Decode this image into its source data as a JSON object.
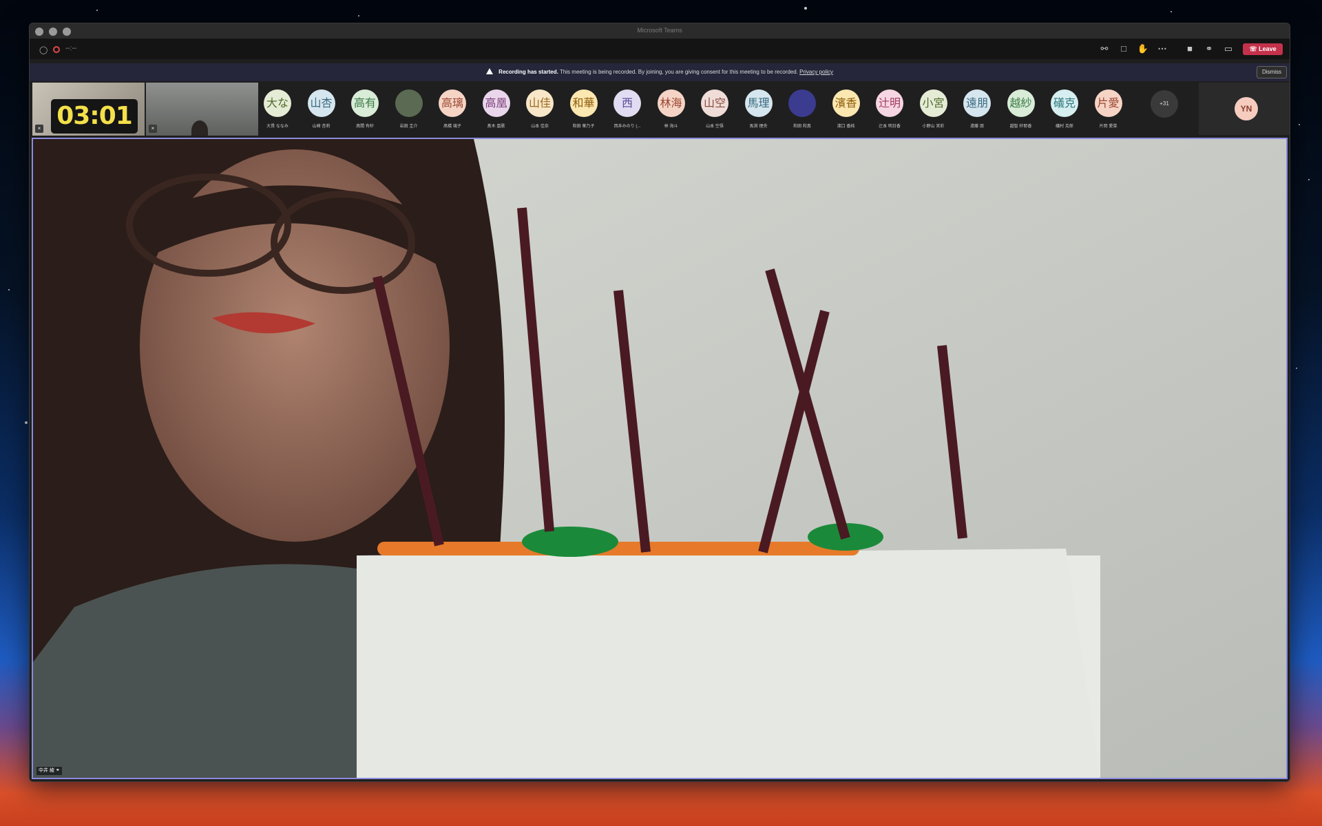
{
  "window": {
    "title": "Microsoft Teams"
  },
  "toolbar": {
    "call_timer": "--:--",
    "leave_label": "Leave"
  },
  "banner": {
    "title": "Recording has started.",
    "message": "This meeting is being recorded. By joining, you are giving consent for this meeting to be recorded.",
    "link": "Privacy policy",
    "dismiss_label": "Dismiss"
  },
  "video_tiles": [
    {
      "clock_text": "03:01"
    },
    {}
  ],
  "participants": [
    {
      "initials": "大な",
      "name": "大貫 ななみ",
      "bg": "#e5ecd6",
      "fg": "#4f6b2a"
    },
    {
      "initials": "山杏",
      "name": "山崎 杏莉",
      "bg": "#d6e6ee",
      "fg": "#3a6a80"
    },
    {
      "initials": "高有",
      "name": "髙間 有紗",
      "bg": "#d8ecd8",
      "fg": "#3c7a46"
    },
    {
      "initials": "",
      "name": "岩田 圭介",
      "bg": "#5b6a52",
      "fg": "#ffffff"
    },
    {
      "initials": "高璃",
      "name": "髙橋 璃子",
      "bg": "#f5d4c6",
      "fg": "#9a4630"
    },
    {
      "initials": "高凰",
      "name": "髙木 凰歌",
      "bg": "#ead6ea",
      "fg": "#7a3f7a"
    },
    {
      "initials": "山佳",
      "name": "山本 佳奈",
      "bg": "#f8e6c8",
      "fg": "#9a6a1e"
    },
    {
      "initials": "和華",
      "name": "和田 華乃子",
      "bg": "#fbe7b0",
      "fg": "#8e5d0c"
    },
    {
      "initials": "西",
      "name": "西井みのり (...",
      "bg": "#e2dcf2",
      "fg": "#5a4a9a"
    },
    {
      "initials": "林海",
      "name": "林 海斗",
      "bg": "#f5d4c6",
      "fg": "#9a4630"
    },
    {
      "initials": "山空",
      "name": "山本 空悟",
      "bg": "#f0ddd8",
      "fg": "#8a4e44"
    },
    {
      "initials": "馬理",
      "name": "馬渕 理央",
      "bg": "#d6e6ee",
      "fg": "#3a6a80"
    },
    {
      "initials": "",
      "name": "和田 和真",
      "bg": "#3b3b8f",
      "fg": "#ffffff"
    },
    {
      "initials": "濱香",
      "name": "濱口 香純",
      "bg": "#fbe7b0",
      "fg": "#8e5d0c"
    },
    {
      "initials": "辻明",
      "name": "辻本 明日香",
      "bg": "#f6d6e2",
      "fg": "#a03a64"
    },
    {
      "initials": "小宮",
      "name": "小野山 宮彩",
      "bg": "#e5ecd6",
      "fg": "#4f6b2a"
    },
    {
      "initials": "遠朋",
      "name": "遠藤 朋",
      "bg": "#d6e6ee",
      "fg": "#3a6a80"
    },
    {
      "initials": "越紗",
      "name": "越智 紗耶香",
      "bg": "#d8ecd8",
      "fg": "#3c7a46"
    },
    {
      "initials": "礒克",
      "name": "礒村 克郎",
      "bg": "#d6eef0",
      "fg": "#2f7a80"
    },
    {
      "initials": "片愛",
      "name": "片岡 愛菜",
      "bg": "#f5d4c6",
      "fg": "#9a4630"
    }
  ],
  "overflow_count": "+31",
  "self": {
    "initials": "YN"
  },
  "main_video": {
    "speaker_name": "中井 綾"
  }
}
